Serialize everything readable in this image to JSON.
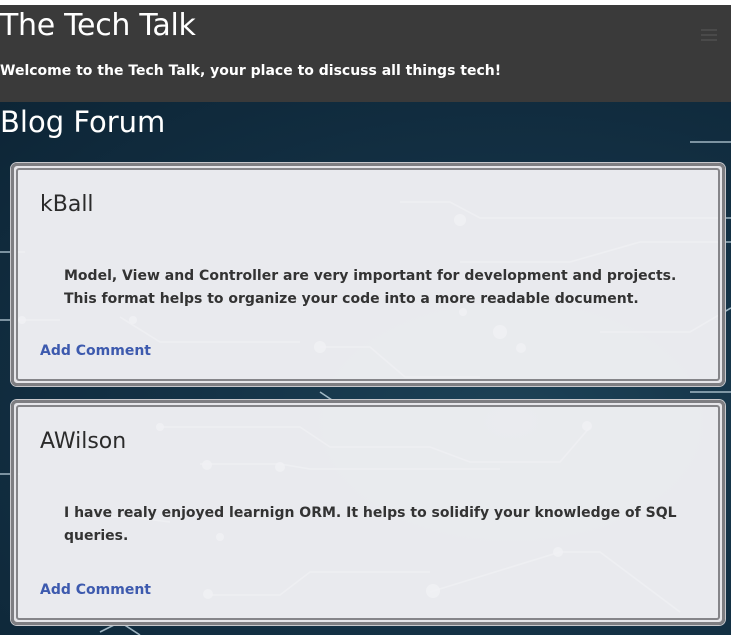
{
  "header": {
    "title": "The Tech Talk",
    "tagline": "Welcome to the Tech Talk, your place to discuss all things tech!"
  },
  "forum": {
    "title": "Blog Forum",
    "posts": [
      {
        "author": "kBall",
        "body": "Model, View and Controller are very important for development and projects. This format helps to organize your code into a more readable document.",
        "action_label": "Add Comment"
      },
      {
        "author": "AWilson",
        "body": "I have realy enjoyed learnign ORM. It helps to solidify your knowledge of SQL queries.",
        "action_label": "Add Comment"
      }
    ]
  },
  "icons": {
    "menu": "hamburger-menu-icon"
  },
  "colors": {
    "header_bg": "#3a3a3a",
    "forum_bg": "#143246",
    "card_bg": "#f1f1f4",
    "card_border": "#7e7e82",
    "link": "#3d5aae",
    "text": "#333333"
  }
}
